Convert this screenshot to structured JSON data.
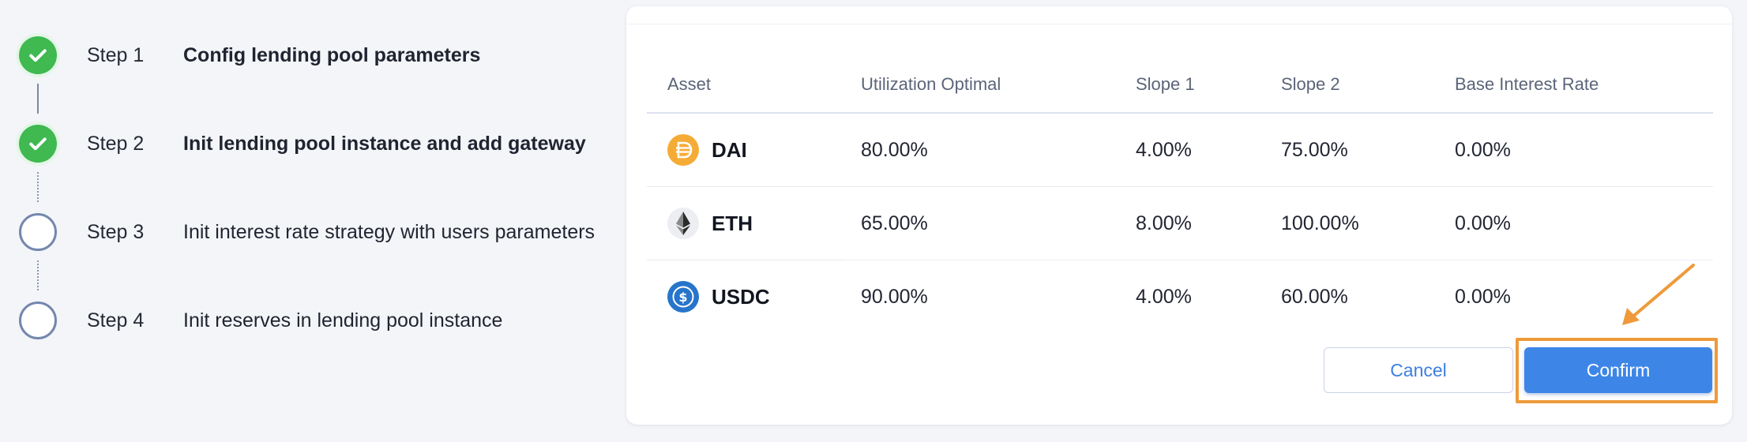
{
  "stepper": {
    "steps": [
      {
        "number": "Step 1",
        "title": "Config lending pool parameters",
        "status": "done"
      },
      {
        "number": "Step 2",
        "title": "Init lending pool instance and add gateway",
        "status": "done"
      },
      {
        "number": "Step 3",
        "title": "Init interest rate strategy with users parameters",
        "status": "pending"
      },
      {
        "number": "Step 4",
        "title": "Init reserves in lending pool instance",
        "status": "pending"
      }
    ]
  },
  "table": {
    "headers": {
      "asset": "Asset",
      "utilization_optimal": "Utilization Optimal",
      "slope1": "Slope 1",
      "slope2": "Slope 2",
      "base_interest_rate": "Base Interest Rate"
    },
    "rows": [
      {
        "asset": "DAI",
        "icon": "dai-icon",
        "utilization_optimal": "80.00%",
        "slope1": "4.00%",
        "slope2": "75.00%",
        "base_interest_rate": "0.00%"
      },
      {
        "asset": "ETH",
        "icon": "eth-icon",
        "utilization_optimal": "65.00%",
        "slope1": "8.00%",
        "slope2": "100.00%",
        "base_interest_rate": "0.00%"
      },
      {
        "asset": "USDC",
        "icon": "usdc-icon",
        "utilization_optimal": "90.00%",
        "slope1": "4.00%",
        "slope2": "60.00%",
        "base_interest_rate": "0.00%"
      }
    ]
  },
  "actions": {
    "cancel_label": "Cancel",
    "confirm_label": "Confirm"
  },
  "colors": {
    "step_done": "#3fb950",
    "step_pending_border": "#7487ad",
    "primary": "#3d86e8",
    "highlight": "#ee9a3a",
    "dai": "#f5ac37",
    "usdc": "#2775ca"
  }
}
